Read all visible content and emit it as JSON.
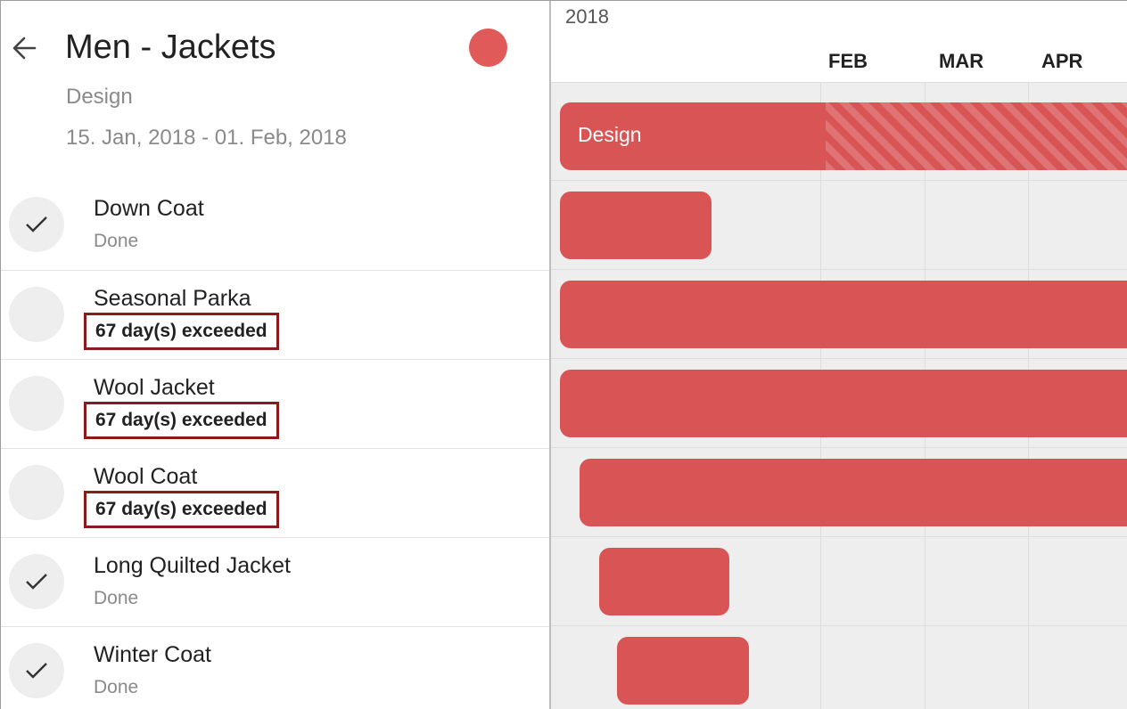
{
  "header": {
    "title": "Men - Jackets",
    "phase": "Design",
    "date_range": "15. Jan, 2018 - 01. Feb, 2018",
    "status_color": "#e05a5a"
  },
  "tasks": [
    {
      "name": "Down Coat",
      "status": "Done",
      "done": true
    },
    {
      "name": "Seasonal Parka",
      "status": "67 day(s) exceeded",
      "done": false,
      "exceeded": true
    },
    {
      "name": "Wool Jacket",
      "status": "67 day(s) exceeded",
      "done": false,
      "exceeded": true
    },
    {
      "name": "Wool Coat",
      "status": "67 day(s) exceeded",
      "done": false,
      "exceeded": true
    },
    {
      "name": "Long Quilted Jacket",
      "status": "Done",
      "done": true
    },
    {
      "name": "Winter Coat",
      "status": "Done",
      "done": true
    }
  ],
  "timeline": {
    "year": "2018",
    "months": [
      "FEB",
      "MAR",
      "APR"
    ],
    "phase_bar_label": "Design",
    "bar_color": "#d95555"
  }
}
